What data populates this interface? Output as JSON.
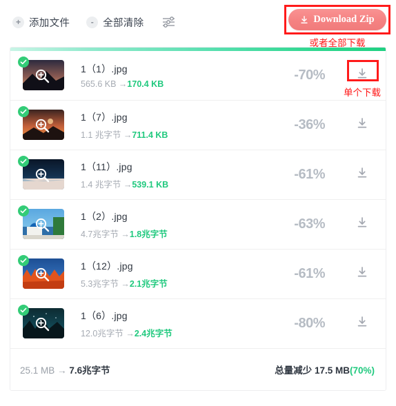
{
  "toolbar": {
    "add_files": {
      "icon": "plus-icon",
      "label": "添加文件"
    },
    "clear_all": {
      "icon": "minus-icon",
      "label": "全部清除"
    },
    "settings_icon": "sliders-icon"
  },
  "download_zip": {
    "label": "Download Zip",
    "icon": "download-icon",
    "color": "#f58282",
    "annotation": "或者全部下载",
    "annotation_color": "#ff1616"
  },
  "row_annotation": {
    "text": "单个下载",
    "color": "#ff1616"
  },
  "progress": {
    "percent": 100,
    "gradient_from": "#c8f5e6",
    "gradient_to": "#20d082"
  },
  "files": [
    {
      "status_icon": "check-circle-icon",
      "zoom_icon": "magnifier-plus-icon",
      "name": "1（1）.jpg",
      "size_before": "565.6 KB",
      "arrow": "→",
      "size_after": "170.4 KB",
      "reduction": "-70%",
      "download_icon": "download-icon",
      "thumb": {
        "kind": "dusk-mountain",
        "sky_top": "#2c2a3e",
        "sky_mid": "#8a5a52",
        "sky_low": "#e0a06a",
        "ground": "#100f17"
      }
    },
    {
      "status_icon": "check-circle-icon",
      "zoom_icon": "magnifier-plus-icon",
      "name": "1（7）.jpg",
      "size_before": "1.1 兆字节",
      "arrow": "→",
      "size_after": "711.4 KB",
      "reduction": "-36%",
      "download_icon": "download-icon",
      "thumb": {
        "kind": "orange-sunset",
        "sky_top": "#3a2420",
        "sky_mid": "#c4603a",
        "sky_low": "#f0953f",
        "ground": "#1d1210"
      }
    },
    {
      "status_icon": "check-circle-icon",
      "zoom_icon": "magnifier-plus-icon",
      "name": "1（11）.jpg",
      "size_before": "1.4 兆字节",
      "arrow": "→",
      "size_after": "539.1 KB",
      "reduction": "-61%",
      "download_icon": "download-icon",
      "thumb": {
        "kind": "night-beach",
        "sky_top": "#0a1628",
        "sky_mid": "#13314f",
        "sky_low": "#3f6d93",
        "ground": "#e5d7cf"
      }
    },
    {
      "status_icon": "check-circle-icon",
      "zoom_icon": "magnifier-plus-icon",
      "name": "1（2）.jpg",
      "size_before": "4.7兆字节",
      "arrow": "→",
      "size_after": "1.8兆字节",
      "reduction": "-63%",
      "download_icon": "download-icon",
      "thumb": {
        "kind": "blue-dome-church",
        "sky_top": "#5aa7e0",
        "sky_mid": "#79bfe8",
        "sky_low": "#2f6fa8",
        "ground": "#f2f2ee"
      }
    },
    {
      "status_icon": "check-circle-icon",
      "zoom_icon": "magnifier-plus-icon",
      "name": "1（12）.jpg",
      "size_before": "5.3兆字节",
      "arrow": "→",
      "size_after": "2.1兆字节",
      "reduction": "-61%",
      "download_icon": "download-icon",
      "thumb": {
        "kind": "autumn-trees",
        "sky_top": "#1d4f94",
        "sky_mid": "#2f6ab4",
        "sky_low": "#4a84c9",
        "ground": "#e2541d"
      }
    },
    {
      "status_icon": "check-circle-icon",
      "zoom_icon": "magnifier-plus-icon",
      "name": "1（6）.jpg",
      "size_before": "12.0兆字节",
      "arrow": "→",
      "size_after": "2.4兆字节",
      "reduction": "-80%",
      "download_icon": "download-icon",
      "thumb": {
        "kind": "night-forest",
        "sky_top": "#0d2b32",
        "sky_mid": "#114450",
        "sky_low": "#1a6b72",
        "ground": "#07171c"
      }
    }
  ],
  "footer": {
    "total_before": "25.1 MB",
    "arrow": "→",
    "total_after": "7.6兆字节",
    "saved_label": "总量减少",
    "saved_size": "17.5 MB",
    "saved_percent": "(70%)"
  }
}
